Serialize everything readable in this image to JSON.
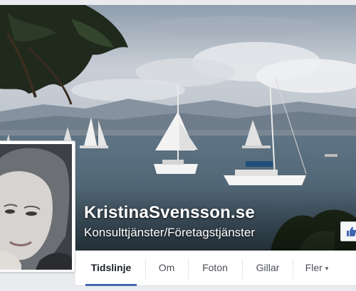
{
  "page": {
    "name": "KristinaSvensson.se",
    "category": "Konsulttjänster/Företagstjänster"
  },
  "nav": {
    "tabs": [
      {
        "label": "Tidslinje",
        "active": true
      },
      {
        "label": "Om",
        "active": false
      },
      {
        "label": "Foton",
        "active": false
      },
      {
        "label": "Gillar",
        "active": false
      },
      {
        "label": "Fler",
        "active": false,
        "icon": "caret-down-icon"
      }
    ],
    "more_caret": "▾"
  },
  "icons": {
    "like": "thumbs-up-icon"
  },
  "colors": {
    "accent": "#4267b2",
    "nav_background": "#ffffff",
    "page_background": "#e9ebee"
  }
}
